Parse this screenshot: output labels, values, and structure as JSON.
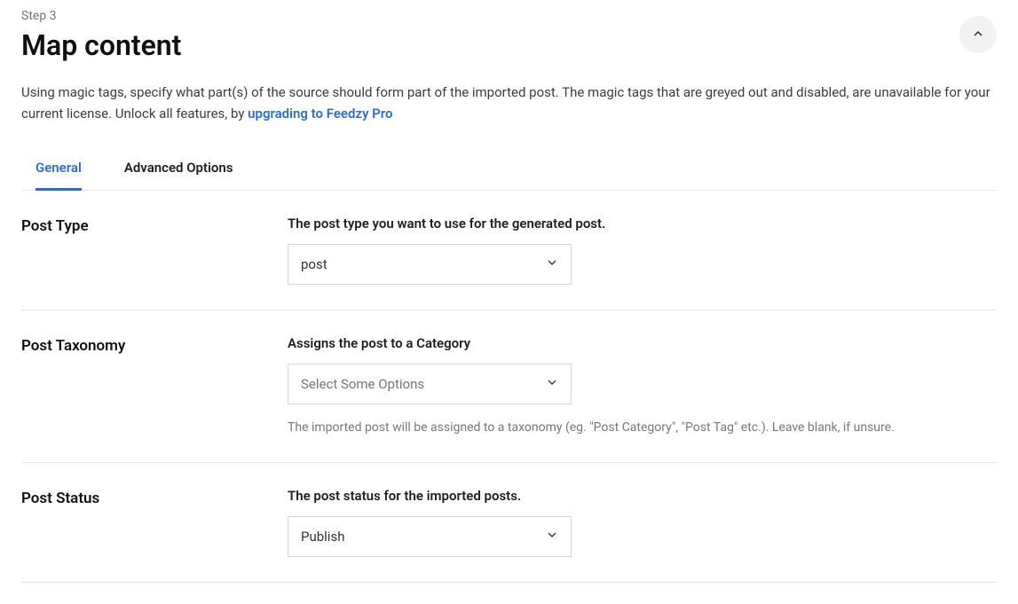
{
  "step": "Step 3",
  "title": "Map content",
  "description_prefix": "Using magic tags, specify what part(s) of the source should form part of the imported post. The magic tags that are greyed out and disabled, are unavailable for your current license. Unlock all features, by ",
  "upgrade_link": "upgrading to Feedzy Pro",
  "tabs": {
    "general": "General",
    "advanced": "Advanced Options"
  },
  "sections": {
    "post_type": {
      "label": "Post Type",
      "desc": "The post type you want to use for the generated post.",
      "value": "post"
    },
    "post_taxonomy": {
      "label": "Post Taxonomy",
      "desc": "Assigns the post to a Category",
      "placeholder": "Select Some Options",
      "help": "The imported post will be assigned to a taxonomy (eg. \"Post Category\", \"Post Tag\" etc.). Leave blank, if unsure."
    },
    "post_status": {
      "label": "Post Status",
      "desc": "The post status for the imported posts.",
      "value": "Publish"
    }
  }
}
